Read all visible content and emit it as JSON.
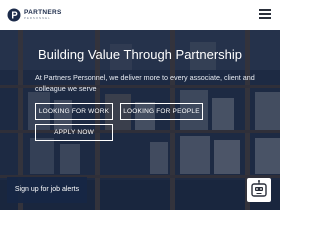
{
  "header": {
    "logo": {
      "name": "PARTNERS",
      "subtitle": "PERSONNEL",
      "icon": "partners-logo-icon"
    },
    "menu_icon": "hamburger-menu-icon"
  },
  "hero": {
    "title": "Building Value Through Partnership",
    "description": "At Partners Personnel, we deliver more to every associate, client and colleague we serve",
    "buttons": {
      "looking_for_work": "LOOKING FOR WORK",
      "looking_for_people": "LOOKING FOR PEOPLE",
      "apply_now": "APPLY NOW"
    },
    "background": "warehouse-shelves-image"
  },
  "job_alerts": {
    "label": "Sign up for job alerts"
  },
  "chat": {
    "icon": "chatbot-icon"
  },
  "colors": {
    "brand_navy": "#1c2b4a",
    "overlay": "#121e37",
    "alerts_bg": "#162644",
    "text_light": "#ffffff"
  }
}
